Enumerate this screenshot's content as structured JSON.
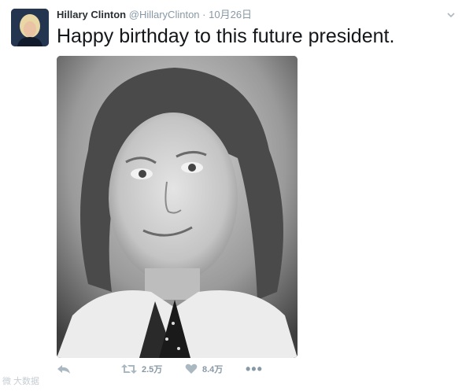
{
  "tweet": {
    "author_name": "Hillary Clinton",
    "author_handle": "@HillaryClinton",
    "separator": "·",
    "date": "10月26日",
    "text": "Happy birthday to this future president.",
    "retweet_count": "2.5万",
    "like_count": "8.4万",
    "more_label": "•••"
  },
  "watermark": "微 大数据"
}
